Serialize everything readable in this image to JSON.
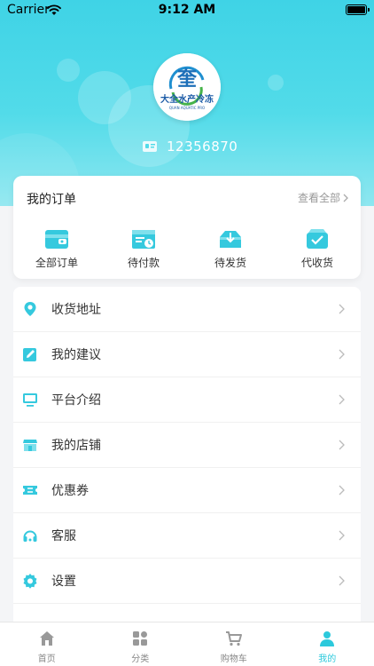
{
  "status_bar": {
    "carrier": "Carrier",
    "time": "9:12 AM"
  },
  "profile": {
    "logo_text_cn": "大全水产冷冻",
    "logo_text_en": "QUAN AQUATIC PRO",
    "logo_char": "奎",
    "user_id": "12356870"
  },
  "orders": {
    "title": "我的订单",
    "view_all": "查看全部",
    "items": [
      {
        "label": "全部订单",
        "icon": "wallet-icon"
      },
      {
        "label": "待付款",
        "icon": "pending-payment-icon"
      },
      {
        "label": "待发货",
        "icon": "pending-shipment-icon"
      },
      {
        "label": "代收货",
        "icon": "pending-receipt-icon"
      }
    ]
  },
  "menu": [
    {
      "label": "收货地址",
      "icon": "location-pin-icon"
    },
    {
      "label": "我的建议",
      "icon": "edit-icon"
    },
    {
      "label": "平台介绍",
      "icon": "monitor-icon"
    },
    {
      "label": "我的店铺",
      "icon": "store-icon"
    },
    {
      "label": "优惠券",
      "icon": "coupon-icon"
    },
    {
      "label": "客服",
      "icon": "headset-icon"
    },
    {
      "label": "设置",
      "icon": "gear-icon"
    }
  ],
  "tabbar": [
    {
      "label": "首页",
      "icon": "home-icon"
    },
    {
      "label": "分类",
      "icon": "category-icon"
    },
    {
      "label": "购物车",
      "icon": "cart-icon"
    },
    {
      "label": "我的",
      "icon": "person-icon",
      "active": true
    }
  ],
  "colors": {
    "accent": "#2cc9dc",
    "hero": "#3fd3e6"
  }
}
